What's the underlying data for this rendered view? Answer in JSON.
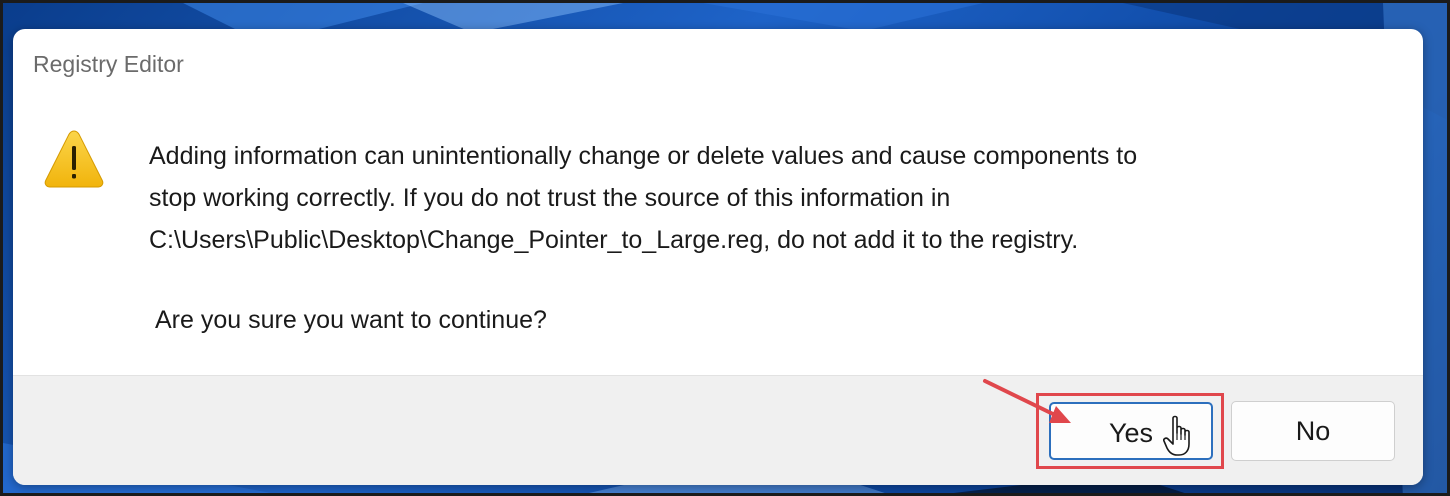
{
  "dialog": {
    "title": "Registry Editor",
    "icon": "warning-icon",
    "message_lines": [
      "Adding information can unintentionally change or delete values and cause components to",
      "stop working correctly. If you do not trust the source of this information in",
      "C:\\Users\\Public\\Desktop\\Change_Pointer_to_Large.reg, do not add it to the registry."
    ],
    "question": "Are you sure you want to continue?",
    "buttons": {
      "yes_label": "Yes",
      "no_label": "No"
    }
  },
  "annotation": {
    "highlight_color": "#e0474c",
    "arrow_color": "#e0474c",
    "cursor": "hand-pointer-icon"
  },
  "colors": {
    "accent_border": "#2c6fbd",
    "footer_bg": "#f0f0f0",
    "warning_yellow": "#f6c21c"
  }
}
